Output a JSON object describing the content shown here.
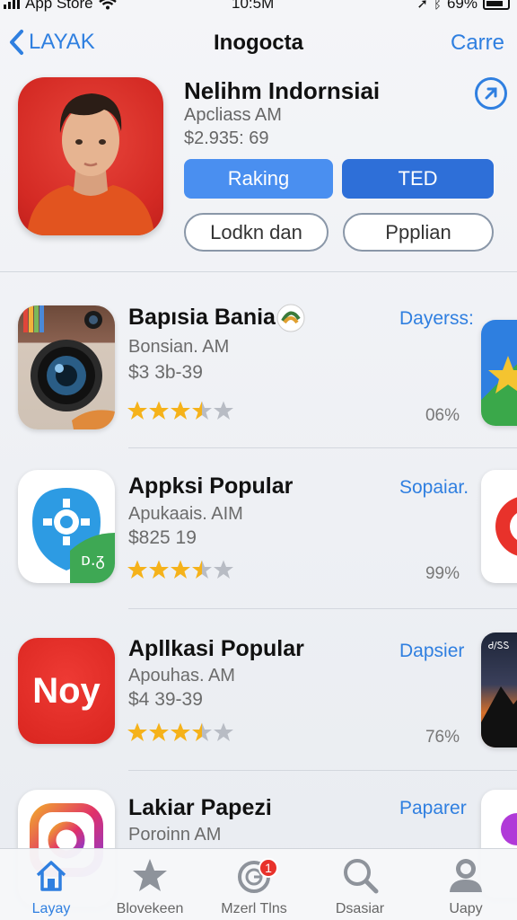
{
  "status_bar": {
    "carrier": "App Store",
    "time": "10:5M",
    "battery": "69%"
  },
  "nav": {
    "back_label": "LAYAK",
    "title": "Inogocta",
    "right_label": "Carre"
  },
  "hero": {
    "name": "Nelihm Indornsiai",
    "subtitle": "Apcliass AM",
    "price": "$2.935: 69",
    "button_1": "Raking",
    "button_2": "TED",
    "button_3": "Lodkn dan",
    "button_4": "Ppplian",
    "icons": {
      "share": "share-arrow-icon"
    }
  },
  "rows": [
    {
      "name": "Bapısia Bania",
      "subtitle": "Bonsian. AM",
      "price": "$3 3b-39",
      "action": "Dayerss:",
      "percent": "06%",
      "rating": 3.5,
      "icon": "camera-app-icon"
    },
    {
      "name": "Appksi Popular",
      "subtitle": "Apukaais. AIM",
      "price": "$825 19",
      "action": "Sopaiar.",
      "percent": "99%",
      "rating": 3.5,
      "icon": "gear-chat-app-icon",
      "icon_badge": "ᴅ.ᵹ"
    },
    {
      "name": "Apllkasi Popular",
      "subtitle": "Apouhas. AM",
      "price": "$4 39-39",
      "action": "Dapsier",
      "percent": "76%",
      "rating": 3.5,
      "icon": "noy-app-icon",
      "icon_text": "Noy",
      "peek_text": "Ꮷ/ᏚᏚ"
    },
    {
      "name": "Lakiar Papezi",
      "subtitle": "Poroinn AM",
      "action": "Paparer",
      "icon": "photo-app-icon"
    }
  ],
  "tabs": [
    {
      "label": "Layay",
      "icon": "home-icon",
      "active": true
    },
    {
      "label": "Blovekeen",
      "icon": "star-icon",
      "active": false
    },
    {
      "label": "Mzerl Tlns",
      "icon": "clock-icon",
      "active": false,
      "badge": "1"
    },
    {
      "label": "Dsasiar",
      "icon": "search-icon",
      "active": false
    },
    {
      "label": "Uapy",
      "icon": "person-icon",
      "active": false
    }
  ],
  "colors": {
    "accent": "#2f7fe0",
    "star": "#f5b21a",
    "star_empty": "#b8bcc4",
    "badge": "#e8322b"
  }
}
